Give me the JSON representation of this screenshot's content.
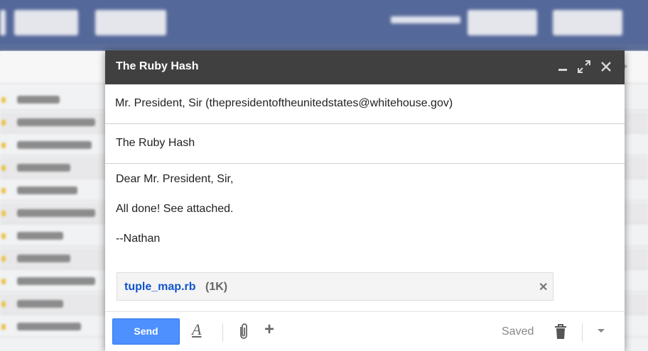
{
  "background": {
    "toolbar_buttons": [
      "",
      "",
      ""
    ],
    "list_rows": 11
  },
  "compose": {
    "title": "The Ruby Hash",
    "minimize_icon": "minimize-icon",
    "expand_icon": "expand-icon",
    "close_icon": "close-icon",
    "to": "Mr. President, Sir (thepresidentoftheunitedstates@whitehouse.gov)",
    "subject": "The Ruby Hash",
    "body_lines": [
      "Dear Mr. President, Sir,",
      "All done! See attached.",
      "--Nathan"
    ],
    "attachment": {
      "name": "tuple_map.rb",
      "size": "(1K)",
      "remove_icon": "close-icon"
    },
    "bottom": {
      "send_label": "Send",
      "format_icon": "text-format-icon",
      "attach_icon": "paperclip-icon",
      "insert_icon": "plus-icon",
      "status": "Saved",
      "discard_icon": "trash-icon",
      "more_icon": "chevron-down-icon"
    },
    "accent_color": "#4d90fe",
    "link_color": "#1155cc"
  }
}
